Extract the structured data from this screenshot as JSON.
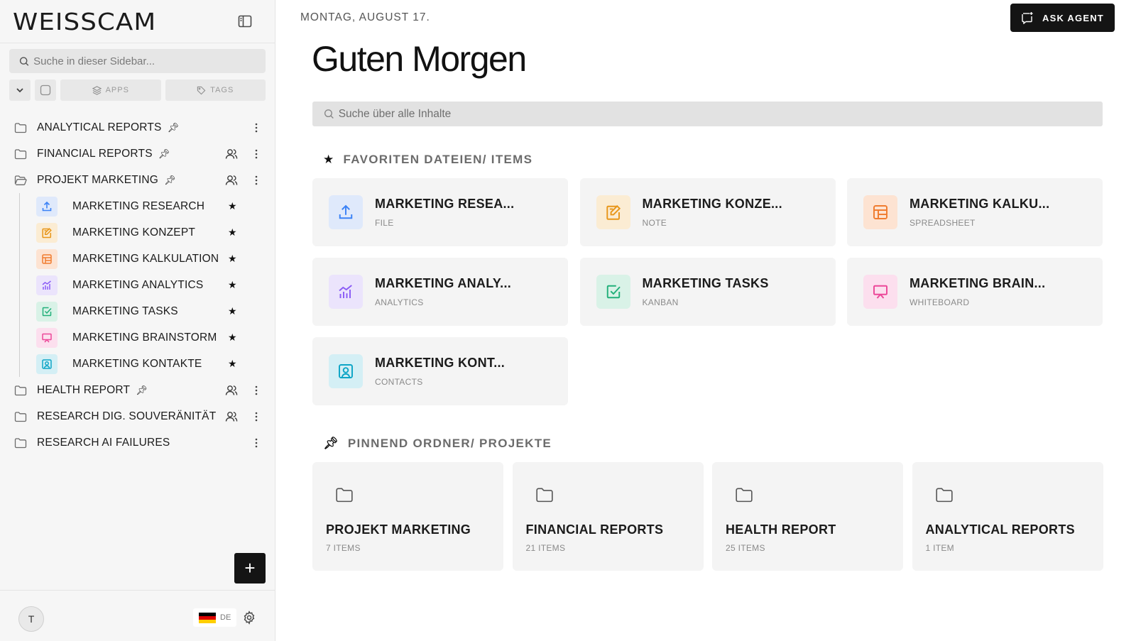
{
  "sidebar": {
    "logo": "WEISSCAM",
    "search_placeholder": "Suche in dieser Sidebar...",
    "tools": {
      "apps_label": "APPS",
      "tags_label": "TAGS"
    },
    "folders": [
      {
        "label": "ANALYTICAL REPORTS",
        "pinned": true,
        "shared": false
      },
      {
        "label": "FINANCIAL REPORTS",
        "pinned": true,
        "shared": true
      },
      {
        "label": "PROJEKT MARKETING",
        "pinned": true,
        "shared": true,
        "open": true
      }
    ],
    "children": [
      {
        "label": "MARKETING RESEARCH",
        "icon": "upload-icon",
        "color": "#3b82f6",
        "bg": "#dfe9fb"
      },
      {
        "label": "MARKETING KONZEPT",
        "icon": "note-icon",
        "color": "#e8961a",
        "bg": "#fbecd3"
      },
      {
        "label": "MARKETING KALKULATION",
        "icon": "spreadsheet-icon",
        "color": "#f07c2f",
        "bg": "#fde3d2"
      },
      {
        "label": "MARKETING ANALYTICS",
        "icon": "analytics-icon",
        "color": "#8b5cf6",
        "bg": "#ebe4fc"
      },
      {
        "label": "MARKETING TASKS",
        "icon": "kanban-icon",
        "color": "#22b07a",
        "bg": "#d9f2e7"
      },
      {
        "label": "MARKETING BRAINSTORM",
        "icon": "whiteboard-icon",
        "color": "#ec4899",
        "bg": "#fcdfee"
      },
      {
        "label": "MARKETING KONTAKTE",
        "icon": "contacts-icon",
        "color": "#0ea5c6",
        "bg": "#d4eff5"
      }
    ],
    "folders_after": [
      {
        "label": "HEALTH REPORT",
        "pinned": true,
        "shared": true
      },
      {
        "label": "RESEARCH DIG. SOUVERÄNITÄT",
        "pinned": false,
        "shared": true
      },
      {
        "label": "RESEARCH AI FAILURES",
        "pinned": false,
        "shared": false
      }
    ],
    "footer": {
      "avatar_initial": "T",
      "language": "DE"
    }
  },
  "header": {
    "date": "MONTAG, AUGUST 17.",
    "ask_agent_label": "ASK AGENT",
    "greeting": "Guten Morgen",
    "search_placeholder": "Suche über alle Inhalte"
  },
  "favorites": {
    "title": "FAVORITEN DATEIEN/ ITEMS",
    "items": [
      {
        "title": "MARKETING RESEA...",
        "type": "FILE",
        "icon": "upload-icon",
        "color": "#3b82f6",
        "bg": "#dfe9fb"
      },
      {
        "title": "MARKETING KONZE...",
        "type": "NOTE",
        "icon": "note-icon",
        "color": "#e8961a",
        "bg": "#fbecd3"
      },
      {
        "title": "MARKETING KALKU...",
        "type": "SPREADSHEET",
        "icon": "spreadsheet-icon",
        "color": "#f07c2f",
        "bg": "#fde3d2"
      },
      {
        "title": "MARKETING ANALY...",
        "type": "ANALYTICS",
        "icon": "analytics-icon",
        "color": "#8b5cf6",
        "bg": "#ebe4fc"
      },
      {
        "title": "MARKETING TASKS",
        "type": "KANBAN",
        "icon": "kanban-icon",
        "color": "#22b07a",
        "bg": "#d9f2e7"
      },
      {
        "title": "MARKETING BRAIN...",
        "type": "WHITEBOARD",
        "icon": "whiteboard-icon",
        "color": "#ec4899",
        "bg": "#fcdfee"
      },
      {
        "title": "MARKETING KONT...",
        "type": "CONTACTS",
        "icon": "contacts-icon",
        "color": "#0ea5c6",
        "bg": "#d4eff5"
      }
    ]
  },
  "pinned": {
    "title": "PINNEND ORDNER/ PROJEKTE",
    "items": [
      {
        "title": "PROJEKT MARKETING",
        "count": "7 ITEMS"
      },
      {
        "title": "FINANCIAL REPORTS",
        "count": "21 ITEMS"
      },
      {
        "title": "HEALTH REPORT",
        "count": "25 ITEMS"
      },
      {
        "title": "ANALYTICAL REPORTS",
        "count": "1 ITEM"
      }
    ]
  }
}
